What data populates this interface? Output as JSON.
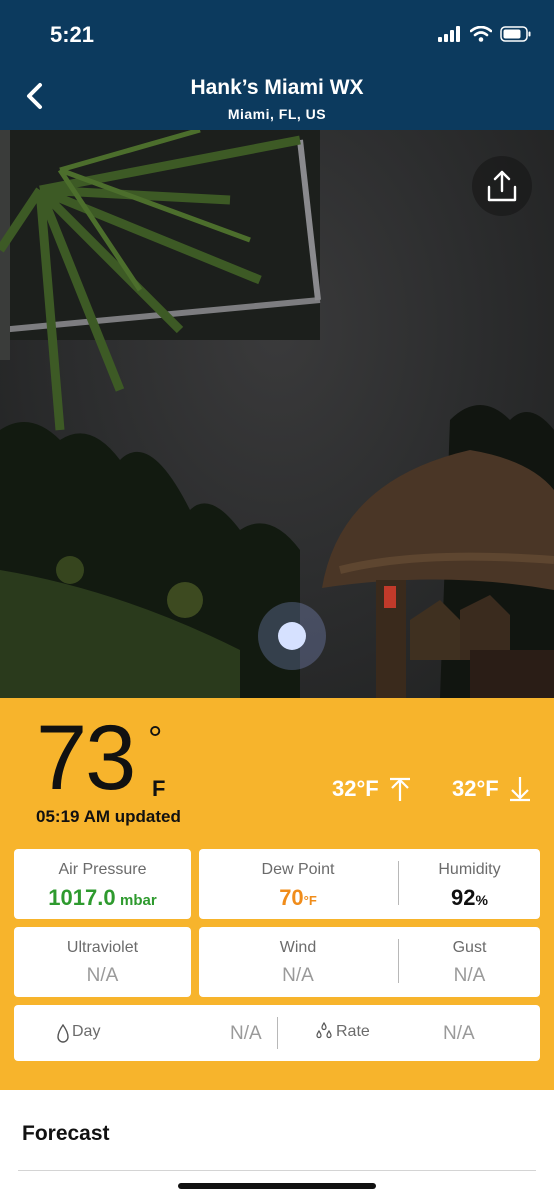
{
  "status_bar": {
    "time": "5:21"
  },
  "header": {
    "title": "Hank’s Miami WX",
    "subtitle": "Miami,  FL,  US"
  },
  "current": {
    "temperature": "73",
    "degree_symbol": "°",
    "unit": "F",
    "updated": "05:19 AM updated",
    "high": "32°F",
    "low": "32°F"
  },
  "cards": {
    "air_pressure": {
      "label": "Air Pressure",
      "value": "1017.0",
      "unit": "mbar"
    },
    "dew_point": {
      "label": "Dew Point",
      "value": "70",
      "unit": "°F"
    },
    "humidity": {
      "label": "Humidity",
      "value": "92",
      "unit": "%"
    },
    "ultraviolet": {
      "label": "Ultraviolet",
      "value": "N/A"
    },
    "wind": {
      "label": "Wind",
      "value": "N/A"
    },
    "gust": {
      "label": "Gust",
      "value": "N/A"
    },
    "rain_day": {
      "label": "Day",
      "value": "N/A"
    },
    "rain_rate": {
      "label": "Rate",
      "value": "N/A"
    }
  },
  "forecast": {
    "title": "Forecast"
  },
  "colors": {
    "header_bg": "#0c3a5e",
    "panel_bg": "#f7b42c",
    "pressure_green": "#2e9a2e",
    "dew_orange": "#f08c1a"
  }
}
